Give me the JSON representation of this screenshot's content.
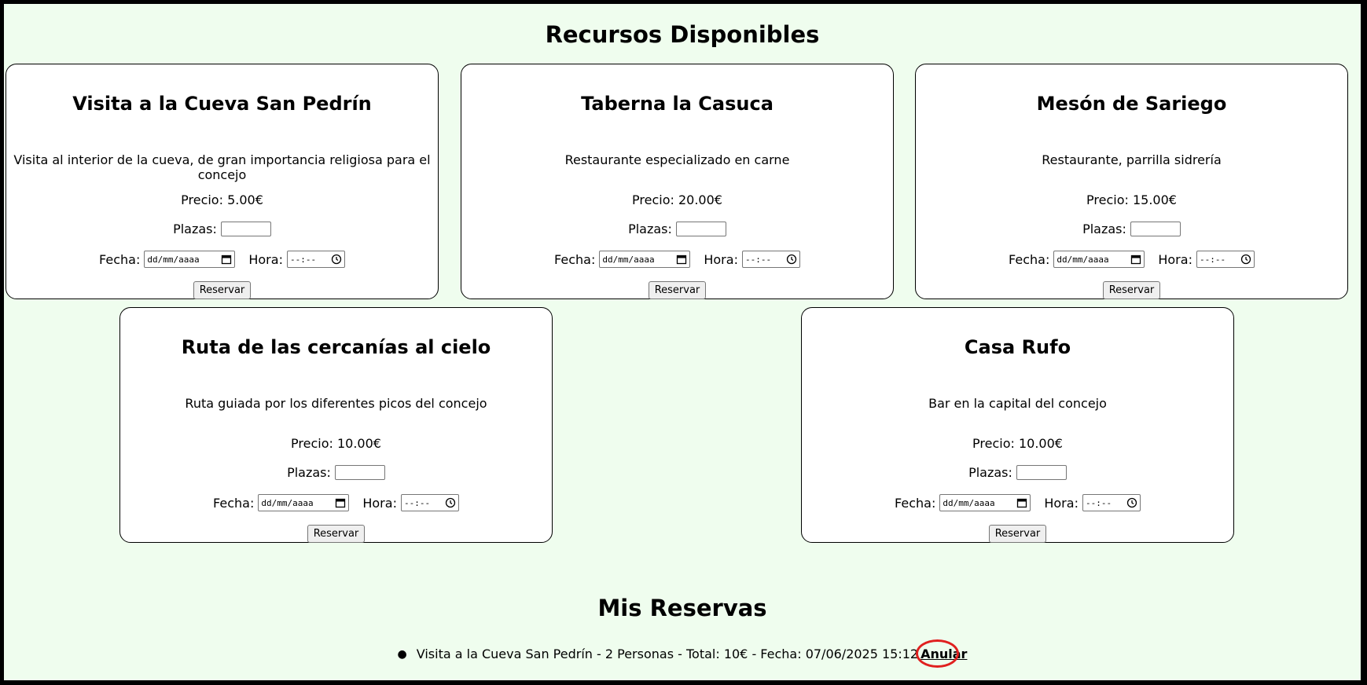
{
  "page": {
    "title": "Recursos Disponibles",
    "reservations_title": "Mis Reservas"
  },
  "labels": {
    "plazas": "Plazas:",
    "fecha": "Fecha:",
    "hora": "Hora:",
    "date_placeholder": "dd/mm/aaaa",
    "time_placeholder": "--:--",
    "reserve_button": "Reservar"
  },
  "resources": [
    {
      "name": "Visita a la Cueva San Pedrín",
      "description": "Visita al interior de la cueva, de gran importancia religiosa para el concejo",
      "price": "Precio: 5.00€"
    },
    {
      "name": "Taberna la Casuca",
      "description": "Restaurante especializado en carne",
      "price": "Precio: 20.00€"
    },
    {
      "name": "Mesón de Sariego",
      "description": "Restaurante, parrilla sidrería",
      "price": "Precio: 15.00€"
    },
    {
      "name": "Ruta de las cercanías al cielo",
      "description": "Ruta guiada por los diferentes picos del concejo",
      "price": "Precio: 10.00€"
    },
    {
      "name": "Casa Rufo",
      "description": "Bar en la capital del concejo",
      "price": "Precio: 10.00€"
    }
  ],
  "reservations": [
    {
      "text": "Visita a la Cueva San Pedrín - 2 Personas - Total: 10€ - Fecha: 07/06/2025 15:12",
      "cancel_label": "Anular"
    }
  ],
  "colors": {
    "page_background": "#effdee",
    "annotation_circle": "#e0201f"
  }
}
